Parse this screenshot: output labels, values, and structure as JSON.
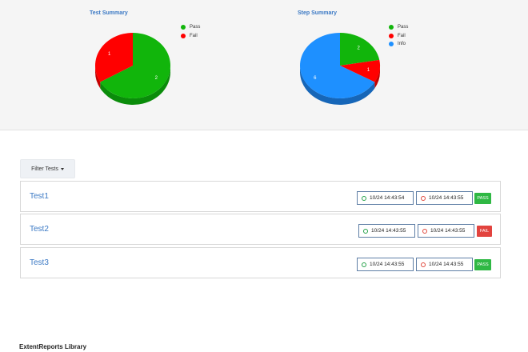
{
  "test_summary": {
    "title": "Test Summary",
    "legend": [
      {
        "label": "Pass",
        "color": "#11b50b"
      },
      {
        "label": "Fail",
        "color": "#ff0000"
      }
    ],
    "slices": [
      {
        "label": "Pass",
        "value": 2,
        "color": "#11b50b",
        "side_color": "#0a8c0a"
      },
      {
        "label": "Fail",
        "value": 1,
        "color": "#ff0000",
        "side_color": "#c40000"
      }
    ]
  },
  "step_summary": {
    "title": "Step Summary",
    "legend": [
      {
        "label": "Pass",
        "color": "#11b50b"
      },
      {
        "label": "Fail",
        "color": "#ff0000"
      },
      {
        "label": "Info",
        "color": "#1e90ff"
      }
    ],
    "slices": [
      {
        "label": "Pass",
        "value": 2,
        "color": "#11b50b",
        "side_color": "#0a8c0a"
      },
      {
        "label": "Fail",
        "value": 1,
        "color": "#ff0000",
        "side_color": "#c40000"
      },
      {
        "label": "Info",
        "value": 6,
        "color": "#1e90ff",
        "side_color": "#1666b8"
      }
    ]
  },
  "filter": {
    "label": "Filter Tests"
  },
  "tests": [
    {
      "name": "Test1",
      "start": "10/24 14:43:54",
      "end": "10/24 14:43:55",
      "status": "PASS"
    },
    {
      "name": "Test2",
      "start": "10/24 14:43:55",
      "end": "10/24 14:43:55",
      "status": "FAIL"
    },
    {
      "name": "Test3",
      "start": "10/24 14:43:55",
      "end": "10/24 14:43:55",
      "status": "PASS"
    }
  ],
  "footer": {
    "label": "ExtentReports Library"
  }
}
